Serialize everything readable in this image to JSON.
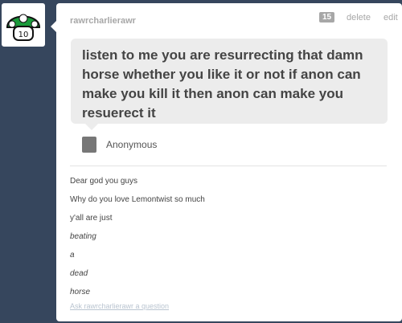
{
  "post": {
    "username": "rawrcharlierawr",
    "notes_count": "15",
    "delete_label": "delete",
    "edit_label": "edit",
    "question": "listen to me you are resurrecting that damn horse whether you like it or not if anon can make you kill it then anon can make you resuerect it",
    "asker": "Anonymous",
    "answer_lines": [
      "Dear god you guys",
      "Why do you love Lemontwist so much",
      "y'all are just",
      "beating",
      "a",
      "dead",
      "horse"
    ],
    "ask_link": "Ask rawrcharlierawr a question"
  },
  "colors": {
    "background": "#36465d",
    "question_bubble": "#ececec",
    "meta_text": "#a7a7a7",
    "avatar_green": "#1a9a3a"
  },
  "icons": {
    "avatar": "green-mushroom-1up-avatar",
    "asker": "anonymous-silhouette-icon"
  }
}
